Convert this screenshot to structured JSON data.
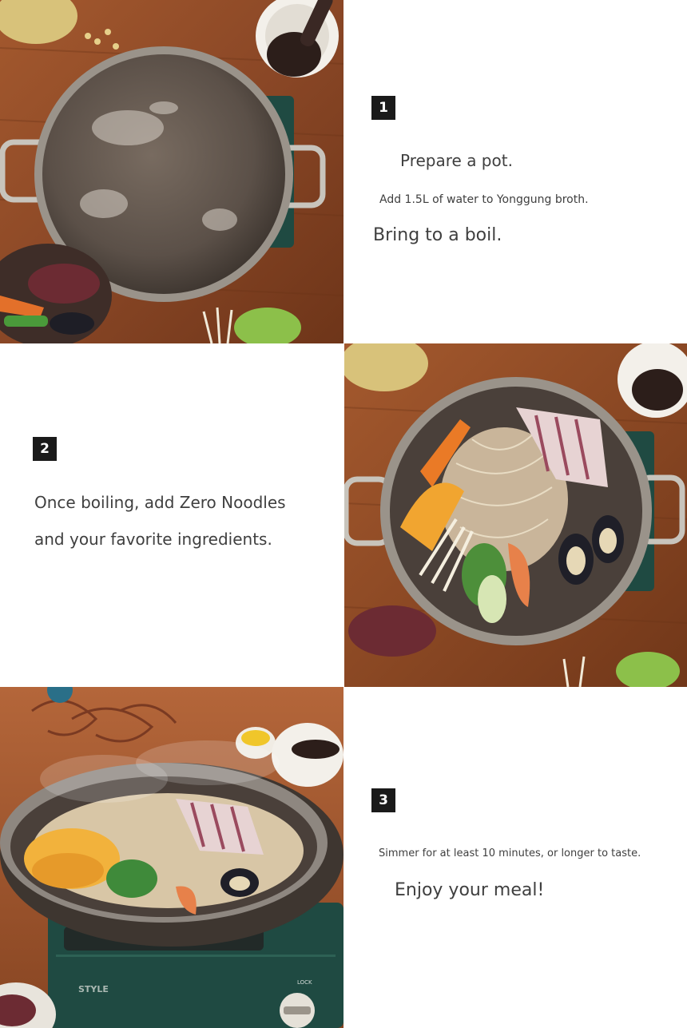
{
  "steps": [
    {
      "number": "1",
      "title": "Prepare a pot.",
      "detail": "Add 1.5L of water to Yonggung broth.",
      "action": "Bring to a boil.",
      "image_alt": "Empty pot of water on a wooden table"
    },
    {
      "number": "2",
      "line1": "Once boiling, add Zero Noodles",
      "line2": "and your favorite ingredients.",
      "image_alt": "Pot filled with noodles, seafood and vegetables"
    },
    {
      "number": "3",
      "detail": "Simmer for at least 10 minutes, or longer to taste.",
      "closing": "Enjoy your meal!",
      "image_alt": "Steaming hot pot on a portable gas stove",
      "stove_brand": "STYLE",
      "stove_lock": "LOCK"
    }
  ],
  "colors": {
    "table_wood": "#8a4a26",
    "pot_metal": "#5d524a",
    "step_badge": "#1a1a1a",
    "stove_green": "#1f4a42",
    "text": "#3f3f3f"
  }
}
